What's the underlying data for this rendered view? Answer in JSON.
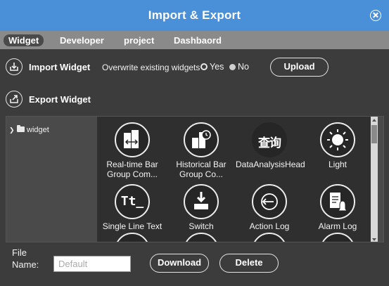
{
  "dialog": {
    "title": "Import & Export"
  },
  "tabs": [
    {
      "label": "Widget",
      "active": true
    },
    {
      "label": "Developer",
      "active": false
    },
    {
      "label": "project",
      "active": false
    },
    {
      "label": "Dashbaord",
      "active": false
    }
  ],
  "import": {
    "title": "Import Widget",
    "overwrite_label": "Overwrite existing widgets",
    "options": [
      {
        "label": "Yes",
        "selected": true
      },
      {
        "label": "No",
        "selected": false
      }
    ],
    "upload_label": "Upload"
  },
  "export": {
    "title": "Export Widget"
  },
  "tree": {
    "root_label": "widget",
    "expanded": false
  },
  "widgets": [
    {
      "label": "Real-time Bar Group Com...",
      "icon": "realtime-bar-icon"
    },
    {
      "label": "Historical Bar Group Co...",
      "icon": "historical-bar-icon"
    },
    {
      "label": "DataAnalysisHead",
      "icon": "query-icon",
      "glyph": "查询"
    },
    {
      "label": "Light",
      "icon": "light-icon"
    },
    {
      "label": "Single Line Text",
      "icon": "text-icon",
      "glyph": "Tt_"
    },
    {
      "label": "Switch",
      "icon": "switch-icon"
    },
    {
      "label": "Action Log",
      "icon": "action-log-icon"
    },
    {
      "label": "Alarm Log",
      "icon": "alarm-log-icon"
    }
  ],
  "footer": {
    "file_name_label_1": "File",
    "file_name_label_2": "Name:",
    "file_name_placeholder": "Default",
    "file_name_value": "",
    "download_label": "Download",
    "delete_label": "Delete"
  },
  "colors": {
    "title_bar": "#4a90d9",
    "tab_bar": "#8a8a8a",
    "background": "#3c3c3c",
    "grid": "#2f2f2f"
  }
}
